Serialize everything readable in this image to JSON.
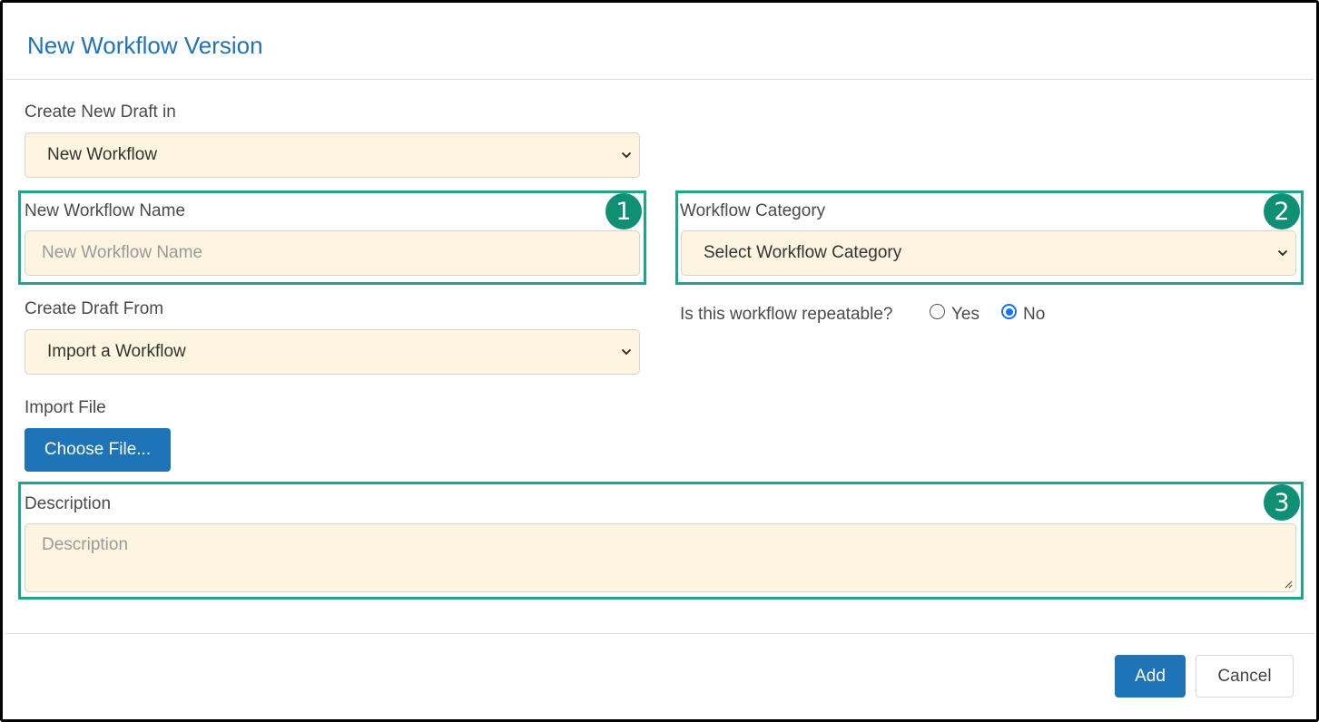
{
  "dialog": {
    "title": "New Workflow Version"
  },
  "form": {
    "create_new_draft_in": {
      "label": "Create New Draft in",
      "value": "New Workflow"
    },
    "new_workflow_name": {
      "label": "New Workflow Name",
      "placeholder": "New Workflow Name"
    },
    "workflow_category": {
      "label": "Workflow Category",
      "value": "Select Workflow Category"
    },
    "create_draft_from": {
      "label": "Create Draft From",
      "value": "Import a Workflow"
    },
    "repeatable": {
      "question": "Is this workflow repeatable?",
      "options": [
        "Yes",
        "No"
      ],
      "selected": "No"
    },
    "import_file": {
      "label": "Import File",
      "button": "Choose File..."
    },
    "description": {
      "label": "Description",
      "placeholder": "Description"
    }
  },
  "callouts": [
    "1",
    "2",
    "3"
  ],
  "footer": {
    "add_label": "Add",
    "cancel_label": "Cancel"
  },
  "colors": {
    "accent": "#1f73b7",
    "callout": "#0f8f74",
    "highlight": "#21a38b",
    "field_bg": "#fdf5e0"
  }
}
